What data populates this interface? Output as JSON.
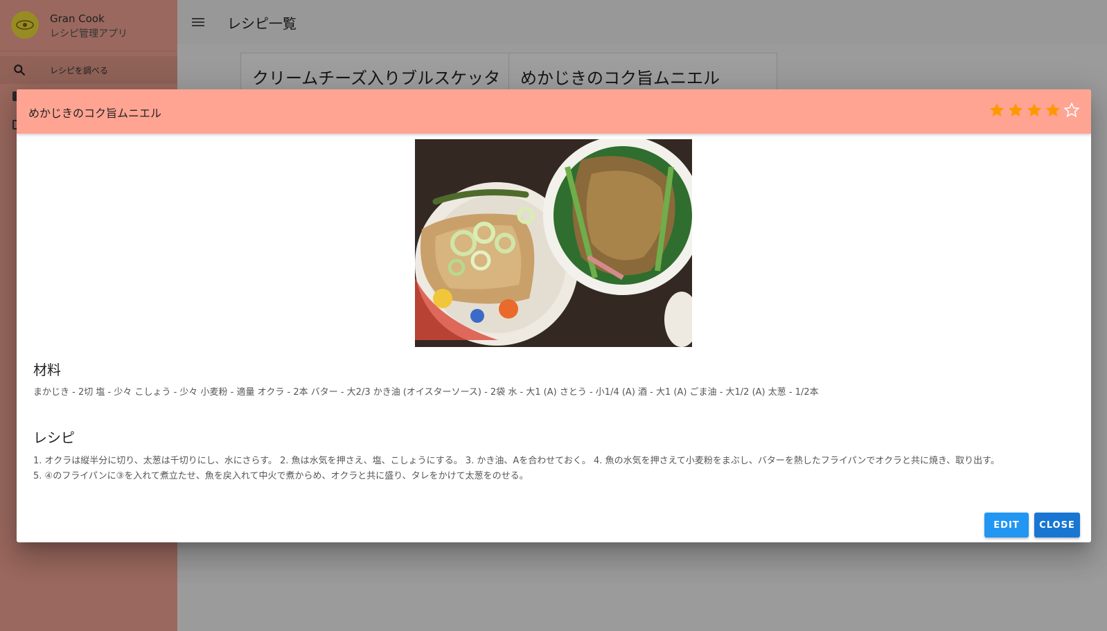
{
  "app": {
    "name": "Gran Cook",
    "subtitle": "レシピ管理アプリ",
    "search_label": "レシピを調べる"
  },
  "header": {
    "title": "レシピ一覧"
  },
  "cards": [
    {
      "title": "クリームチーズ入りブルスケッタ"
    },
    {
      "title": "めかじきのコク旨ムニエル"
    }
  ],
  "dialog": {
    "title": "めかじきのコク旨ムニエル",
    "rating": 4,
    "rating_max": 5,
    "star_color": "#ff9800",
    "header_color": "#ffa493",
    "ingredients_heading": "材料",
    "ingredients": "まかじき - 2切 塩 - 少々 こしょう - 少々 小麦粉 - 適量 オクラ - 2本 バター - 大2/3 かき油 (オイスターソース) - 2袋 水 - 大1 (A) さとう - 小1/4 (A) 酒 - 大1 (A) ごま油 - 大1/2 (A) 太葱 - 1/2本",
    "recipe_heading": "レシピ",
    "recipe_line1": "1. オクラは縦半分に切り、太葱は千切りにし、水にさらす。 2. 魚は水気を押さえ、塩、こしょうにする。 3. かき油、Aを合わせておく。 4. 魚の水気を押さえて小麦粉をまぶし、バターを熱したフライパンでオクラと共に焼き、取り出す。",
    "recipe_line2": "5. ④のフライパンに③を入れて煮立たせ、魚を戻入れて中火で煮からめ、オクラと共に盛り、タレをかけて太葱をのせる。",
    "edit_label": "EDIT",
    "close_label": "CLOSE"
  }
}
